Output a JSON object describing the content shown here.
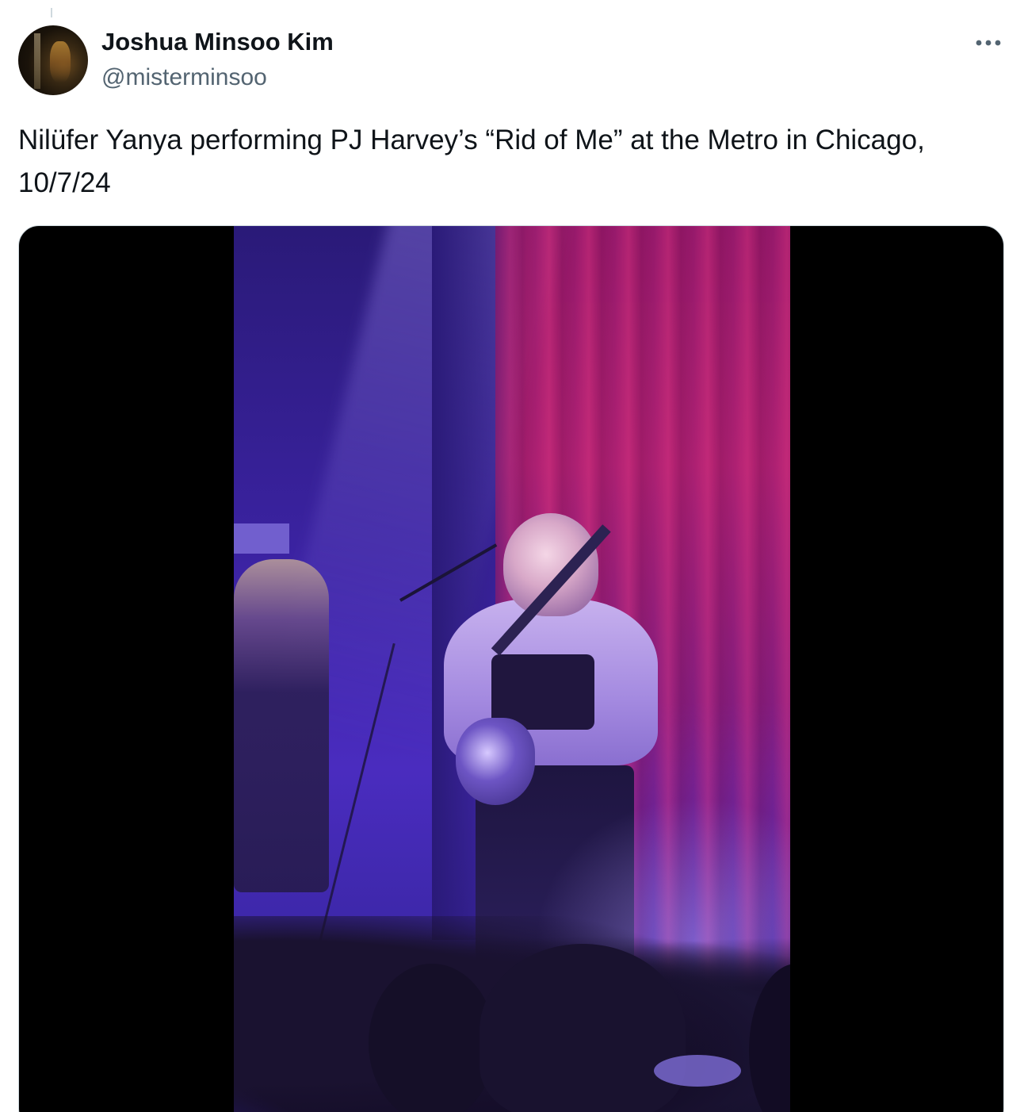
{
  "tweet": {
    "author": {
      "display_name": "Joshua Minsoo Kim",
      "handle": "@misterminsoo",
      "avatar_icon": "profile-photo"
    },
    "more_icon": "more-horizontal-icon",
    "text": "Nilüfer Yanya performing PJ Harvey’s “Rid of Me” at the Metro in Chicago, 10/7/24",
    "media": {
      "type": "video",
      "description_icon": "concert-video-thumbnail"
    }
  },
  "colors": {
    "text_primary": "#0f1419",
    "text_secondary": "#536471",
    "border": "#cfd9de",
    "media_background": "#000000"
  }
}
